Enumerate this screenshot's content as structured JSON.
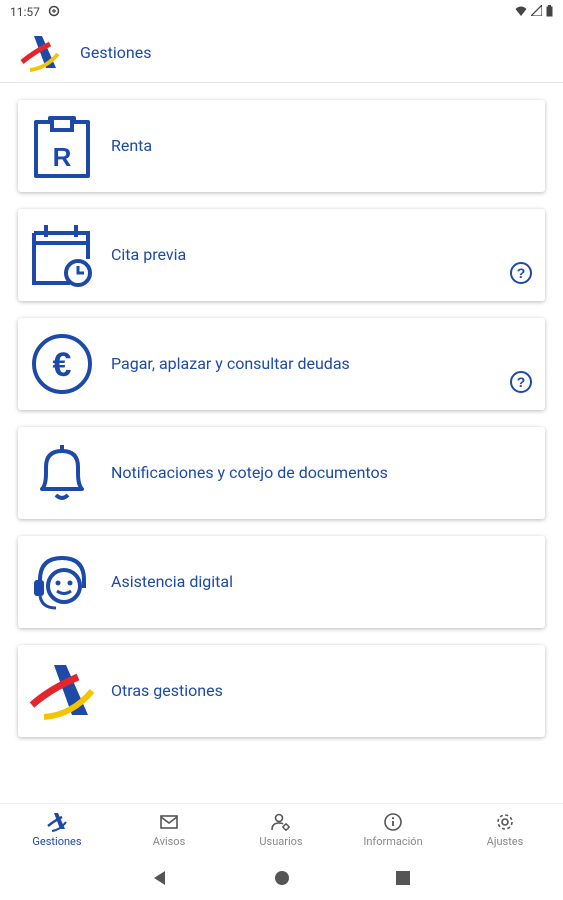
{
  "status_bar": {
    "time": "11:57"
  },
  "app_bar": {
    "title": "Gestiones"
  },
  "menu": {
    "items": [
      {
        "label": "Renta",
        "icon": "renta-document-icon",
        "help": false
      },
      {
        "label": "Cita previa",
        "icon": "calendar-clock-icon",
        "help": true
      },
      {
        "label": "Pagar, aplazar y consultar deudas",
        "icon": "euro-icon",
        "help": true
      },
      {
        "label": "Notificaciones y cotejo de documentos",
        "icon": "bell-icon",
        "help": false
      },
      {
        "label": "Asistencia digital",
        "icon": "assistant-headset-icon",
        "help": false
      },
      {
        "label": "Otras gestiones",
        "icon": "agencia-tributaria-logo-icon",
        "help": false
      }
    ]
  },
  "bottom_nav": {
    "items": [
      {
        "label": "Gestiones",
        "icon": "agencia-logo-icon",
        "active": true
      },
      {
        "label": "Avisos",
        "icon": "mail-icon",
        "active": false
      },
      {
        "label": "Usuarios",
        "icon": "user-settings-icon",
        "active": false
      },
      {
        "label": "Información",
        "icon": "info-icon",
        "active": false
      },
      {
        "label": "Ajustes",
        "icon": "gear-icon",
        "active": false
      }
    ]
  },
  "colors": {
    "brand_blue": "#1d4aa8",
    "accent_yellow": "#f5c400",
    "accent_red": "#e3262e"
  }
}
